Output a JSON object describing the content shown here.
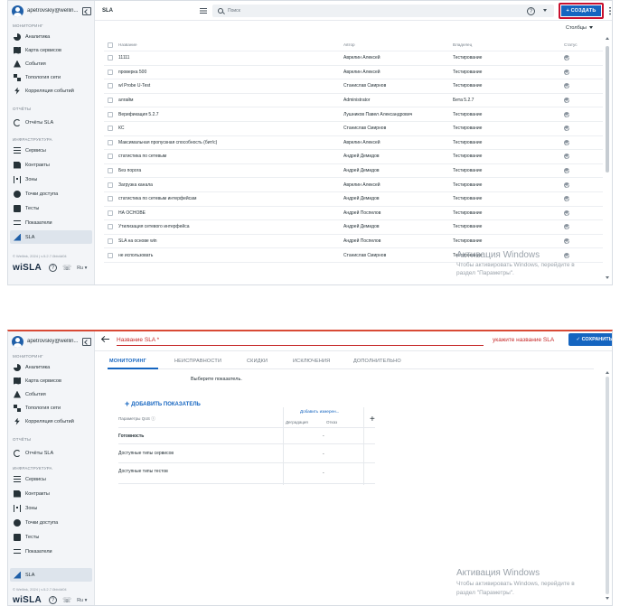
{
  "sidebar": {
    "username": "apetrovskiy@wellin...",
    "sections": {
      "monitoring": "МОНИТОРИНГ",
      "reports": "ОТЧЁТЫ",
      "infrastructure": "ИНФРАСТРУКТУРА"
    },
    "items": [
      {
        "label": "Аналитика",
        "icon": "pie-chart-icon"
      },
      {
        "label": "Карта сервисов",
        "icon": "map-icon"
      },
      {
        "label": "События",
        "icon": "warning-icon"
      },
      {
        "label": "Топология сети",
        "icon": "topology-icon"
      },
      {
        "label": "Корреляция событий",
        "icon": "bolt-icon"
      },
      {
        "label": "Отчёты SLA",
        "icon": "report-icon"
      },
      {
        "label": "Сервисы",
        "icon": "list-icon"
      },
      {
        "label": "Контракты",
        "icon": "document-icon"
      },
      {
        "label": "Зоны",
        "icon": "zones-icon"
      },
      {
        "label": "Точки доступа",
        "icon": "access-point-icon"
      },
      {
        "label": "Тесты",
        "icon": "tests-icon"
      },
      {
        "label": "Показатели",
        "icon": "indicators-icon"
      },
      {
        "label": "SLA",
        "icon": "sla-icon"
      }
    ],
    "copyright": "© Wellink, 2024 | v.5.2.7.0bb4d04",
    "logo": "wiSLA",
    "help": "?",
    "lang": "Ru ▾"
  },
  "list_view": {
    "title": "SLA",
    "search_placeholder": "Поиск",
    "help": "?",
    "create_label": "+ СОЗДАТЬ",
    "columns_label": "Столбцы",
    "headers": {
      "name": "Название",
      "author": "Автор",
      "owner": "Владелец",
      "status": "Статус"
    },
    "rows": [
      {
        "name": "11111",
        "author": "Аврелин Алексей",
        "owner": "Тестирование"
      },
      {
        "name": "проверка 500",
        "author": "Аврелин Алексей",
        "owner": "Тестирование"
      },
      {
        "name": "wl Probe U-Test",
        "author": "Станислав Смирнов",
        "owner": "Тестирование"
      },
      {
        "name": "алгайм",
        "author": "Administrator",
        "owner": "Бета 5.2.7"
      },
      {
        "name": "Верификация 5.2.7",
        "author": "Лушников Павел Александрович",
        "owner": "Тестирование"
      },
      {
        "name": "КС",
        "author": "Станислав Смирнов",
        "owner": "Тестирование"
      },
      {
        "name": "Максимальная пропускная способность (бит/с)",
        "author": "Аврелин Алексей",
        "owner": "Тестирование"
      },
      {
        "name": "статистика по сетевым",
        "author": "Андрей Демидов",
        "owner": "Тестирование"
      },
      {
        "name": "Без порога",
        "author": "Андрей Демидов",
        "owner": "Тестирование"
      },
      {
        "name": "Загрузка канала",
        "author": "Аврелин Алексей",
        "owner": "Тестирование"
      },
      {
        "name": "статистика по сетевым интерфейсам",
        "author": "Андрей Демидов",
        "owner": "Тестирование"
      },
      {
        "name": "НА ОСНОВЕ",
        "author": "Андрей Поспелов",
        "owner": "Тестирование"
      },
      {
        "name": "Утилизация сетевого интерфейса",
        "author": "Андрей Демидов",
        "owner": "Тестирование"
      },
      {
        "name": "SLA на основе win",
        "author": "Андрей Поспелов",
        "owner": "Тестирование"
      },
      {
        "name": "не использовать",
        "author": "Станислав Смирнов",
        "owner": "Тестирование"
      }
    ]
  },
  "watermark": {
    "title": "Активация Windows",
    "line1": "Чтобы активировать Windows, перейдите в",
    "line2": "раздел \"Параметры\"."
  },
  "edit_view": {
    "name_placeholder": "Название SLA *",
    "error_text": "укажите название SLA",
    "save_label": "✓ СОХРАНИТЬ",
    "tabs": [
      "МОНИТОРИНГ",
      "НЕИСПРАВНОСТИ",
      "СКИДКИ",
      "ИСКЛЮЧЕНИЯ",
      "ДОПОЛНИТЕЛЬНО"
    ],
    "hint": "Выберите показатель.",
    "add_indicator": "ДОБАВИТЬ ПОКАЗАТЕЛЬ",
    "qos_header": "Параметры QoS",
    "add_dimension": "Добавить измерен...",
    "degradation": "Деградация",
    "failure": "Отказ",
    "params": [
      {
        "name": "Готовность",
        "value": "-"
      },
      {
        "name": "Доступные типы сервисов",
        "value": "-"
      },
      {
        "name": "Доступные типы тестов",
        "value": "-"
      }
    ]
  },
  "colors": {
    "accent": "#1565c0",
    "error": "#c62828",
    "highlight": "#c8102e"
  }
}
